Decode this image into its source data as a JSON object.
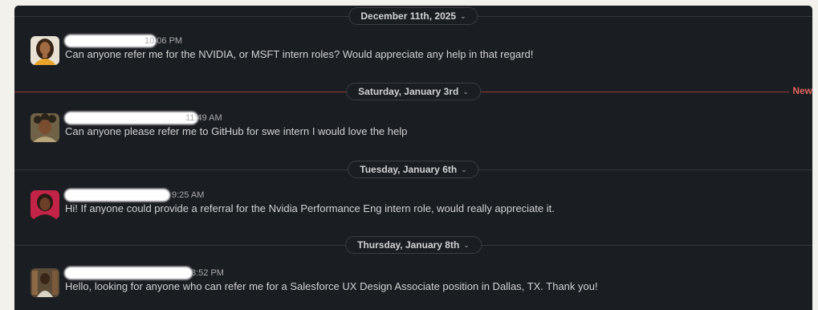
{
  "dividers": [
    {
      "label": "December 11th, 2025"
    },
    {
      "label": "Saturday, January 3rd",
      "new_label": "New"
    },
    {
      "label": "Tuesday, January 6th"
    },
    {
      "label": "Thursday, January 8th"
    }
  ],
  "chevron": "⌄",
  "messages": [
    {
      "time": "10:06 PM",
      "text": "Can anyone refer me for the NVIDIA, or MSFT intern roles? Would appreciate any help in that regard!"
    },
    {
      "time": "11:49 AM",
      "text": "Can anyone please refer me to GitHub for swe intern I would love the help"
    },
    {
      "time": "9:25 AM",
      "text": "Hi! If anyone could provide a referral for the Nvidia Performance Eng intern role, would really appreciate it."
    },
    {
      "time": "3:52 PM",
      "text": "Hello, looking for anyone who can refer me for a Salesforce UX Design Associate position in Dallas, TX. Thank you!"
    }
  ],
  "colors": {
    "background": "#1a1d21",
    "text": "#d1d2d3",
    "new_divider": "#9b3a37",
    "new_label": "#e0655d"
  }
}
